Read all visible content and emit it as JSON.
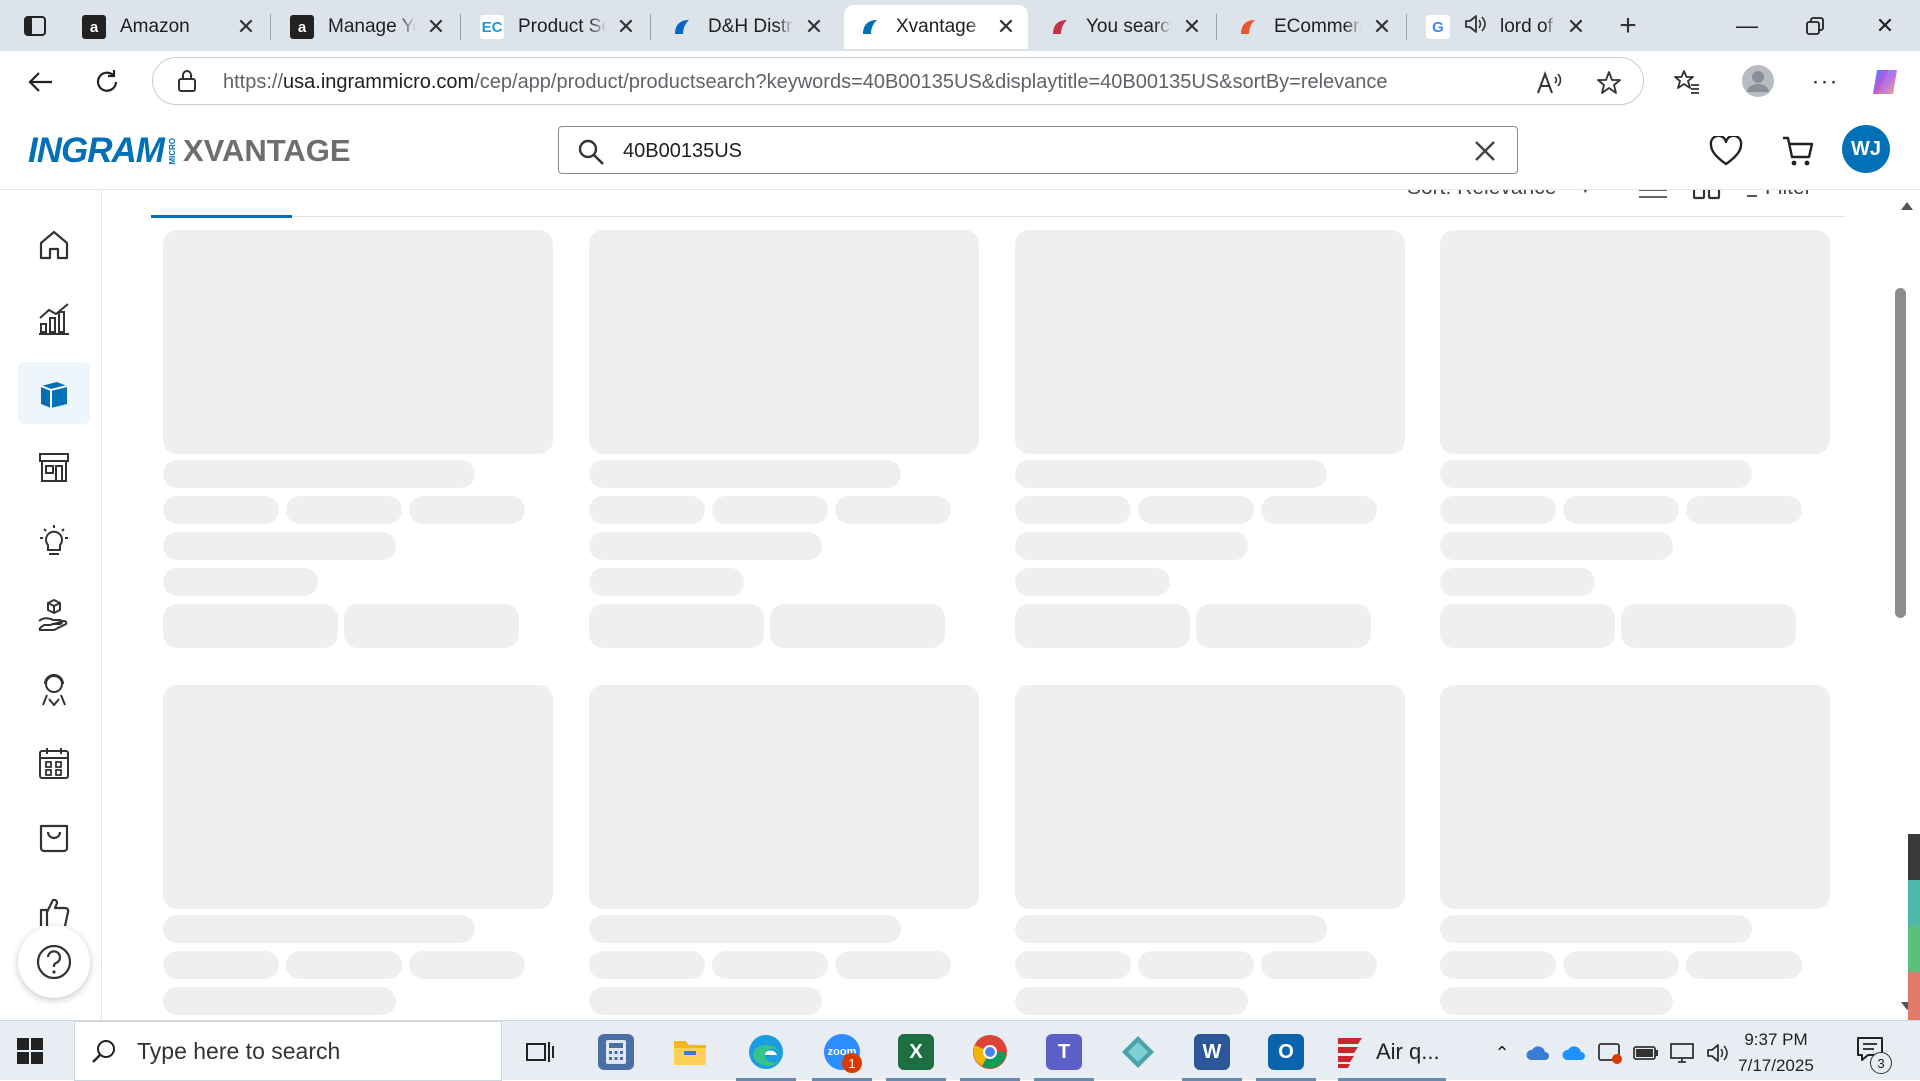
{
  "browser": {
    "tabs": [
      {
        "title": "Amazon",
        "favicon": "amazon-icon",
        "fav_glyph": "a",
        "fav_bg": "#222222",
        "fav_fg": "#ffffff"
      },
      {
        "title": "Manage Your",
        "favicon": "amazon-icon",
        "fav_glyph": "a",
        "fav_bg": "#222222",
        "fav_fg": "#ffffff"
      },
      {
        "title": "Product Search",
        "favicon": "ec-icon",
        "fav_glyph": "EC",
        "fav_bg": "#ffffff",
        "fav_fg": "#1b9bd7"
      },
      {
        "title": "D&H Distributing",
        "favicon": "dh-icon",
        "fav_glyph": "",
        "fav_bg": "#ffffff",
        "fav_fg": "#0a63c9"
      },
      {
        "title": "Xvantage",
        "favicon": "xvantage-icon",
        "fav_glyph": "",
        "fav_bg": "#ffffff",
        "fav_fg": "#0071b9"
      },
      {
        "title": "You searched",
        "favicon": "search-people-icon",
        "fav_glyph": "",
        "fav_bg": "#ffffff",
        "fav_fg": "#c4314b"
      },
      {
        "title": "ECommerce",
        "favicon": "ecommerce-icon",
        "fav_glyph": "",
        "fav_bg": "#ffffff",
        "fav_fg": "#e8552f"
      },
      {
        "title": "lord of",
        "favicon": "google-icon",
        "fav_glyph": "G",
        "fav_bg": "#ffffff",
        "fav_fg": "#4285f4"
      }
    ],
    "url_prefix": "https://",
    "url_host": "usa.ingrammicro.com",
    "url_path": "/cep/app/product/productsearch?keywords=40B00135US&displaytitle=40B00135US&sortBy=relevance"
  },
  "app": {
    "search_value": "40B00135US",
    "logo_brand": "INGRAM",
    "logo_micro": "MICRO",
    "logo_product": "XVANTAGE",
    "avatar_initials": "WJ",
    "accent": "#0071b9"
  },
  "results": {
    "sort_label": "Sort: Relevance",
    "filter_label": "Filter"
  },
  "rail": {
    "items": [
      {
        "name": "home-icon"
      },
      {
        "name": "analytics-icon"
      },
      {
        "name": "products-icon",
        "active": true
      },
      {
        "name": "storefront-icon"
      },
      {
        "name": "lightbulb-icon"
      },
      {
        "name": "hand-box-icon"
      },
      {
        "name": "support-agent-icon"
      },
      {
        "name": "calendar-icon"
      },
      {
        "name": "bag-icon"
      },
      {
        "name": "thumbs-up-icon"
      }
    ]
  },
  "taskbar": {
    "search_placeholder": "Type here to search",
    "air_label": "Air q...",
    "time": "9:37 PM",
    "date": "7/17/2025",
    "zoom_badge": "1",
    "notification_count": "3"
  }
}
